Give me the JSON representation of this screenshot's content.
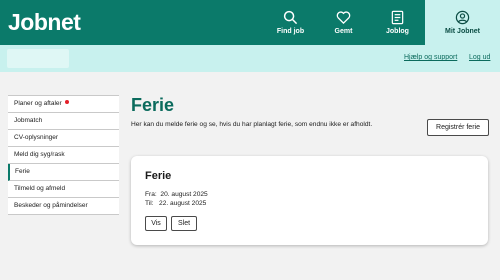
{
  "header": {
    "logo": "Jobnet",
    "nav": [
      {
        "label": "Find job",
        "icon": "search-icon"
      },
      {
        "label": "Gemt",
        "icon": "heart-icon"
      },
      {
        "label": "Joblog",
        "icon": "log-icon"
      },
      {
        "label": "Mit Jobnet",
        "icon": "user-icon",
        "active": true
      }
    ]
  },
  "subbar": {
    "help_label": "Hjælp og support",
    "logout_label": "Log ud"
  },
  "sidebar": {
    "items": [
      {
        "label": "Planer og aftaler",
        "badge": true
      },
      {
        "label": "Jobmatch"
      },
      {
        "label": "CV-oplysninger"
      },
      {
        "label": "Meld dig syg/rask"
      },
      {
        "label": "Ferie",
        "active": true
      },
      {
        "label": "Tilmeld og afmeld"
      },
      {
        "label": "Beskeder og påmindelser"
      }
    ]
  },
  "main": {
    "title": "Ferie",
    "description": "Her kan du melde ferie og se, hvis du har planlagt ferie, som endnu ikke er afholdt.",
    "register_button": "Registrér ferie",
    "card": {
      "title": "Ferie",
      "from_label": "Fra:",
      "from_date": "20. august 2025",
      "to_label": "Til:",
      "to_date": "22. august 2025",
      "view_button": "Vis",
      "delete_button": "Slet"
    }
  },
  "colors": {
    "brand": "#0b7a6a",
    "subbar": "#c8f1ee",
    "badge": "#e3202a"
  }
}
